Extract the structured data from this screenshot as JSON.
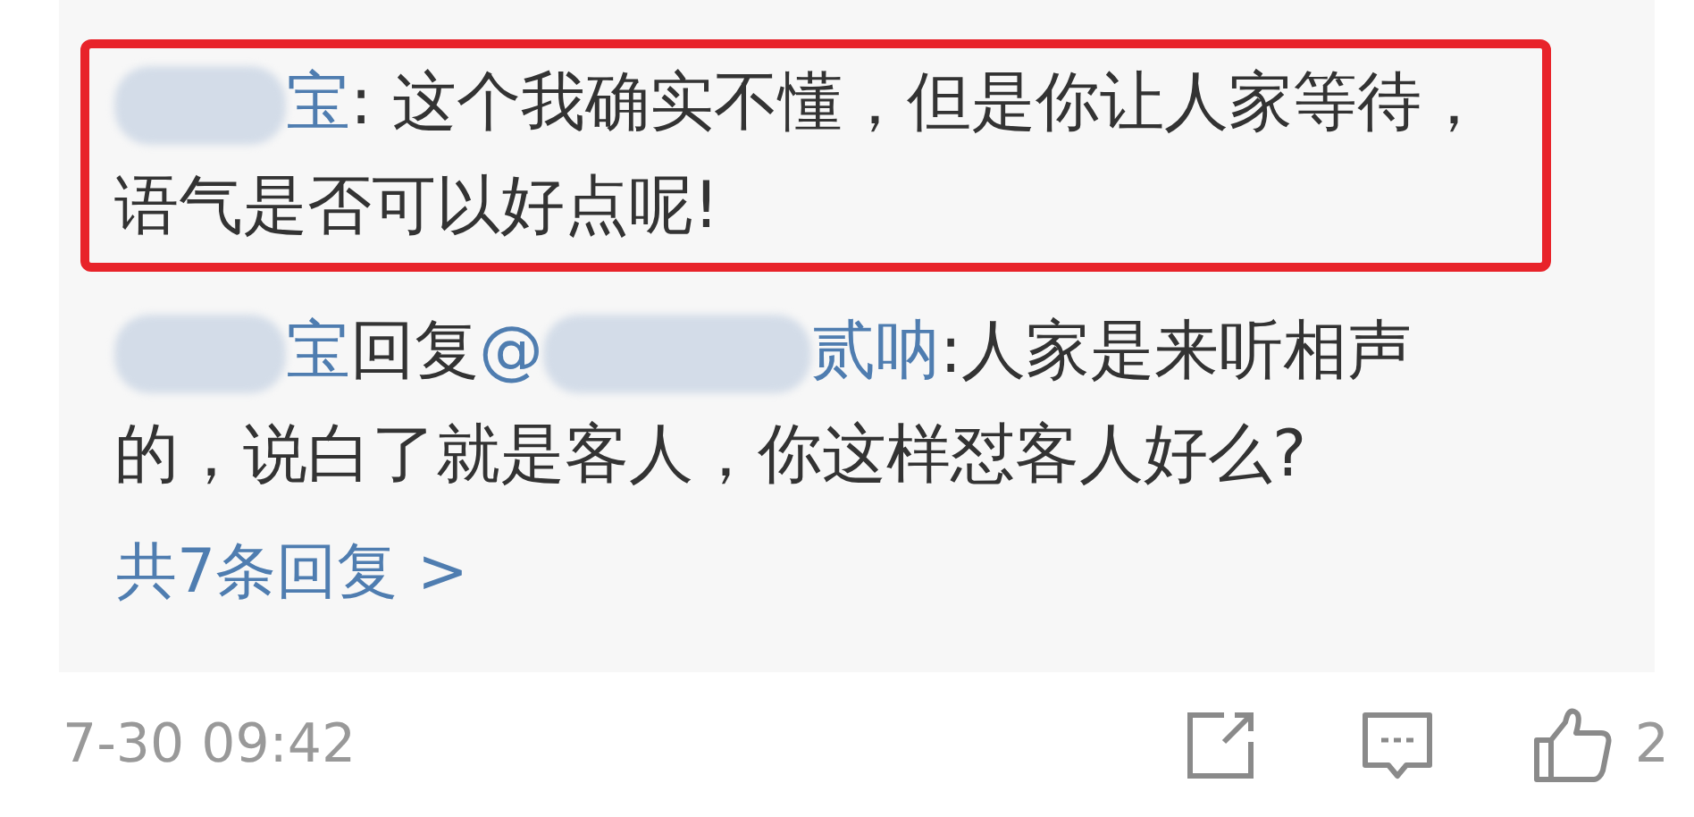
{
  "replies": [
    {
      "author": "宝",
      "separator": ": ",
      "text": "这个我确实不懂，但是你让人家等待，语气是否可以好点呢!",
      "highlighted": true
    },
    {
      "author": "宝",
      "verb": "回复",
      "mention": "@",
      "mention_tail": "贰呐",
      "separator": ":",
      "text": "人家是来听相声的，说白了就是客人，你这样怼客人好么?",
      "highlighted": false
    }
  ],
  "more_replies": "共7条回复 >",
  "footer": {
    "time": "7-30 09:42",
    "like_count": "2"
  }
}
